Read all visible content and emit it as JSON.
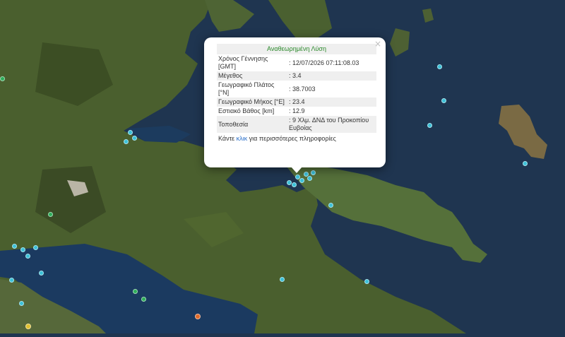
{
  "popup": {
    "header": "Αναθεωρημένη Λύση",
    "close": "×",
    "rows": [
      {
        "label": "Χρόνος Γέννησης [GMT]",
        "value": ": 12/07/2026 07:11:08.03"
      },
      {
        "label": "Μέγεθος",
        "value": ": 3.4"
      },
      {
        "label": "Γεωγραφικό Πλάτος [°N]",
        "value": ": 38.7003"
      },
      {
        "label": "Γεωγραφικό Μήκος [°E]",
        "value": ": 23.4"
      },
      {
        "label": "Εστιακό Βάθος [km]",
        "value": ": 12.9"
      },
      {
        "label": "Τοποθεσία",
        "value": ": 9 Χλμ. ΔΝΔ του Προκοπίου Ευβοίας"
      }
    ],
    "more_prefix": "Κάντε ",
    "more_link": "κλικ",
    "more_suffix": " για περισσότερες πληροφορίες"
  },
  "marker_colors": {
    "cyan": "#3cc1d8",
    "green": "#2eae5a",
    "orange": "#e06a2a",
    "yellow": "#e0c030"
  }
}
